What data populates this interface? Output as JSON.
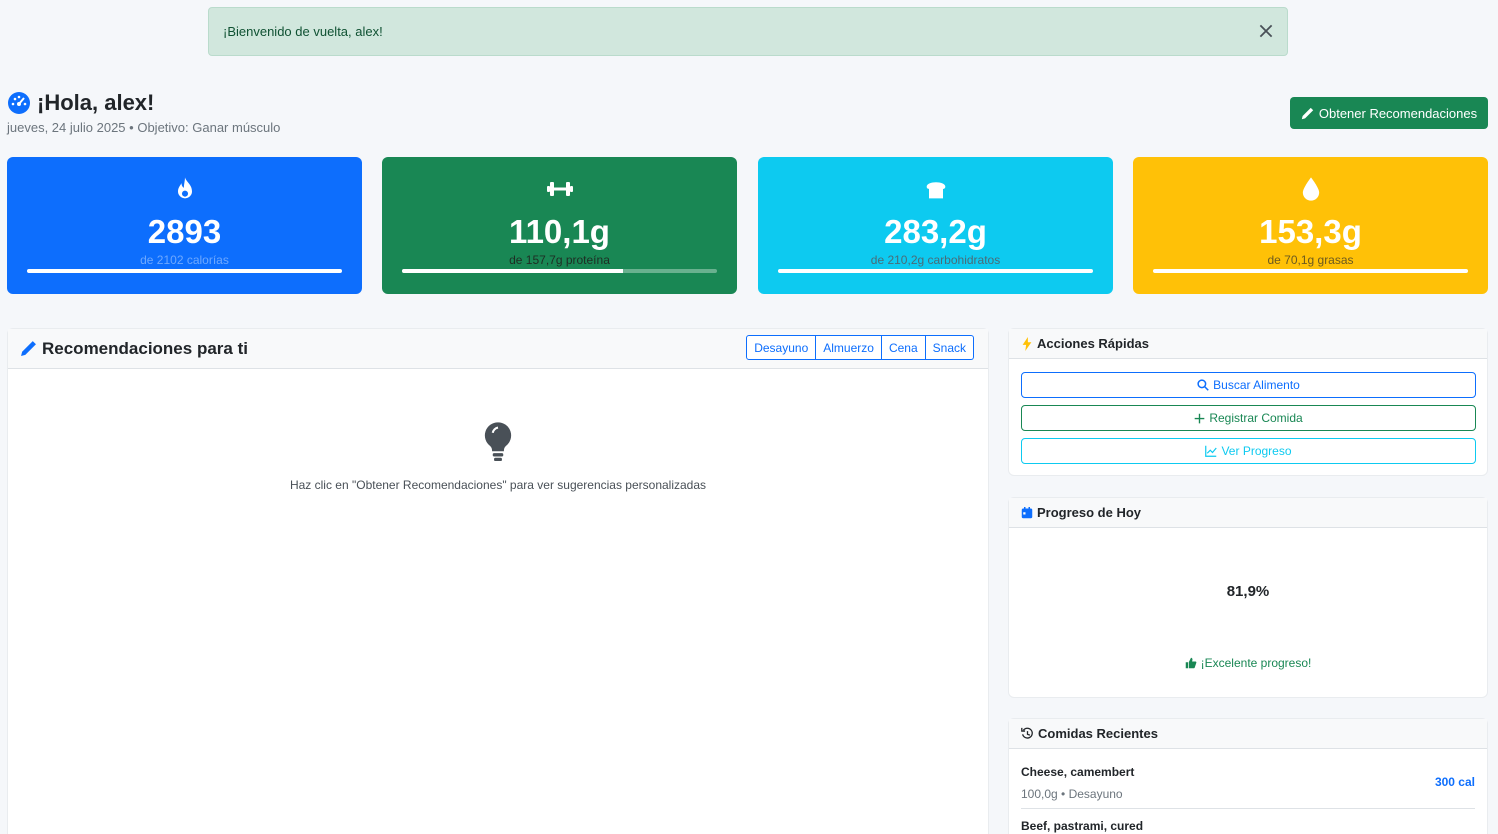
{
  "alert": {
    "message": "¡Bienvenido de vuelta, alex!"
  },
  "header": {
    "greeting": "¡Hola, alex!",
    "date": "jueves, 24 julio 2025",
    "separator": "•",
    "goal": "Objetivo: Ganar músculo",
    "reco_button": "Obtener Recomendaciones"
  },
  "stats": [
    {
      "value": "2893",
      "label": "de 2102 calorías",
      "color": "#0d6efd",
      "icon": "fire-icon",
      "progress": 1.0
    },
    {
      "value": "110,1g",
      "label": "de 157,7g proteína",
      "color": "#198754",
      "icon": "dumbbell-icon",
      "progress": 0.7
    },
    {
      "value": "283,2g",
      "label": "de 210,2g carbohidratos",
      "color": "#0dcaf0",
      "icon": "bread-icon",
      "progress": 1.0
    },
    {
      "value": "153,3g",
      "label": "de 70,1g grasas",
      "color": "#ffc107",
      "icon": "droplet-icon",
      "progress": 1.0
    }
  ],
  "recommendations": {
    "title": "Recomendaciones para ti",
    "meals": [
      "Desayuno",
      "Almuerzo",
      "Cena",
      "Snack"
    ],
    "empty_text": "Haz clic en \"Obtener Recomendaciones\" para ver sugerencias personalizadas"
  },
  "quick_actions": {
    "title": "Acciones Rápidas",
    "search": "Buscar Alimento",
    "log": "Registrar Comida",
    "progress": "Ver Progreso"
  },
  "today_progress": {
    "title": "Progreso de Hoy",
    "percent": "81,9%",
    "message": "¡Excelente progreso!"
  },
  "recent_meals": {
    "title": "Comidas Recientes",
    "items": [
      {
        "name": "Cheese, camembert",
        "meta": "100,0g • Desayuno",
        "cal": "300 cal"
      },
      {
        "name": "Beef, pastrami, cured",
        "meta": "",
        "cal": ""
      }
    ]
  }
}
